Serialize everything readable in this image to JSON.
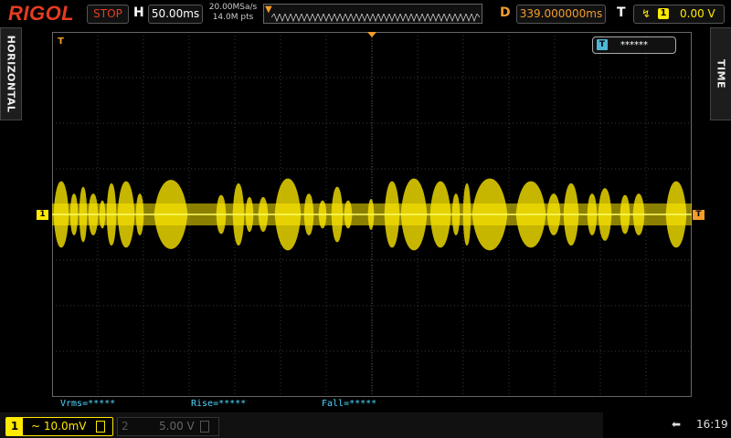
{
  "topbar": {
    "logo": "RIGOL",
    "run_state": "STOP",
    "h_label": "H",
    "timebase": "50.00ms",
    "sample_rate": "20.00MSa/s",
    "mem_depth": "14.0M pts",
    "d_label": "D",
    "delay": "339.000000ms",
    "t_label": "T",
    "trigger_source": "1",
    "trigger_level": "0.00 V"
  },
  "side": {
    "left_tab": "HORIZONTAL",
    "right_tab": "TIME"
  },
  "screen": {
    "trigger_flag": "******",
    "ch1_marker": "1",
    "trigger_marker": "T",
    "trig_pos_marker": "T",
    "trace_color": "#ffea00",
    "grid_color": "#3a3a3a"
  },
  "measurements": {
    "vrms": "Vrms=*****",
    "rise": "Rise=*****",
    "fall": "Fall=*****"
  },
  "bottombar": {
    "ch1_num": "1",
    "ch1_scale": "~ 10.0mV",
    "ch2_num": "2",
    "ch2_scale": "5.00 V",
    "usb_icon": "usb-icon",
    "time": "16:19"
  }
}
